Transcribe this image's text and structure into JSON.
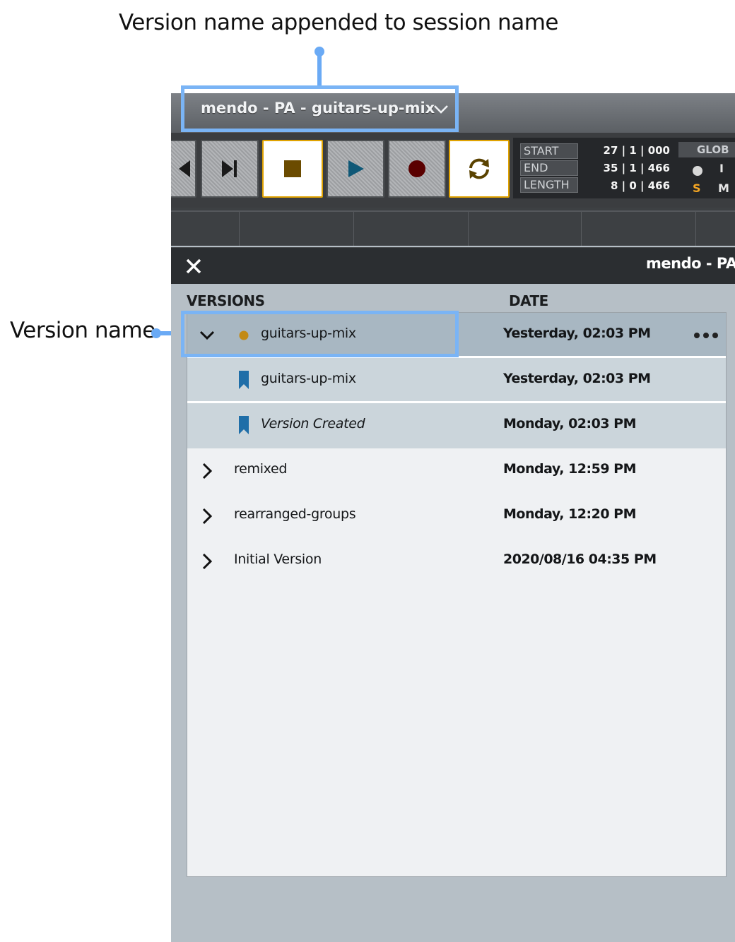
{
  "annotations": {
    "top_callout": "Version name appended to session name",
    "left_callout": "Version name"
  },
  "titlebar": {
    "session_title": "mendo - PA - guitars-up-mix"
  },
  "transport": {
    "buttons": [
      {
        "icon": "rewind-icon",
        "active": false
      },
      {
        "icon": "skip-to-end-icon",
        "active": false
      },
      {
        "icon": "stop-icon",
        "active": true,
        "color": "#6b4b00"
      },
      {
        "icon": "play-icon",
        "active": false,
        "color": "#0f5877"
      },
      {
        "icon": "record-icon",
        "active": false,
        "color": "#5a0000"
      },
      {
        "icon": "loop-icon",
        "active": true,
        "color": "#5a4200"
      }
    ]
  },
  "counter": {
    "start_label": "START",
    "end_label": "END",
    "length_label": "LENGTH",
    "start_value": "27 | 1 | 000",
    "end_value": "35 | 1 | 466",
    "length_value": "8 | 0 | 466",
    "glob_label": "GLOB",
    "glob_i": "I",
    "glob_s": "S",
    "glob_m": "M"
  },
  "panel": {
    "title": "mendo - PA -",
    "columns": {
      "versions": "VERSIONS",
      "date": "DATE"
    },
    "rows": [
      {
        "name": "guitars-up-mix",
        "date": "Yesterday, 02:03 PM",
        "state": "expanded",
        "icon": "current-version-dot-icon",
        "accent": "#c28a15"
      },
      {
        "name": "guitars-up-mix",
        "date": "Yesterday, 02:03 PM",
        "state": "sub",
        "icon": "bookmark-icon",
        "accent": "#1f6ea8"
      },
      {
        "name": "Version Created",
        "date": "Monday, 02:03 PM",
        "state": "sub",
        "icon": "bookmark-icon",
        "accent": "#1f6ea8"
      },
      {
        "name": "remixed",
        "date": "Monday, 12:59 PM",
        "state": "collapsed",
        "icon": "chevron-right-icon"
      },
      {
        "name": "rearranged-groups",
        "date": "Monday, 12:20 PM",
        "state": "collapsed",
        "icon": "chevron-right-icon"
      },
      {
        "name": "Initial Version",
        "date": "2020/08/16 04:35 PM",
        "state": "collapsed",
        "icon": "chevron-right-icon"
      }
    ]
  }
}
